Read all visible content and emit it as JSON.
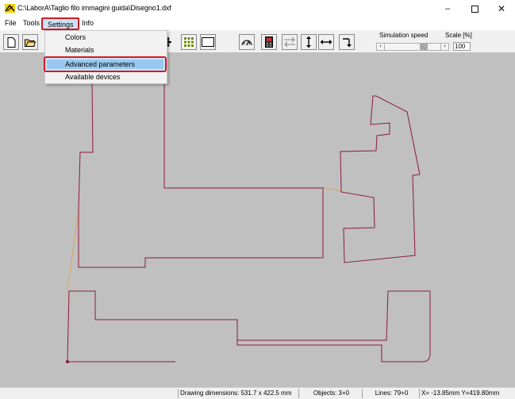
{
  "window": {
    "title": "C:\\LaborA\\Taglio filo immagini guida\\Disegno1.dxf",
    "minimize_icon": "minimize-icon",
    "maximize_icon": "maximize-icon",
    "close_icon": "close-icon"
  },
  "menubar": {
    "file": "File",
    "tools": "Tools",
    "settings": "Settings",
    "info": "Info"
  },
  "settings_menu": {
    "items": [
      "Colors",
      "Materials",
      "Advanced parameters",
      "Available devices"
    ],
    "highlighted": "Advanced parameters"
  },
  "toolbar": {
    "simulation_speed_label": "Simulation speed",
    "scale_label": "Scale [%]",
    "scale_value": "100",
    "icons": [
      "new-file-icon",
      "open-folder-icon",
      "move-icon",
      "grid-icon",
      "rectangle-icon",
      "speed-gauge-icon",
      "device-icon",
      "swap-direction-icon",
      "vertical-arrow-icon",
      "horizontal-arrow-icon",
      "turn-arrow-icon"
    ]
  },
  "colors": {
    "canvas_bg": "#c0c0c0",
    "path_color": "#8b1a3c",
    "travel_color": "#e0a040",
    "highlight_border": "#d21b24",
    "menu_highlight": "#99c9f0"
  },
  "statusbar": {
    "drawing_dimensions": "Drawing dimensions: 531.7 x 422.5 mm",
    "objects": "Objects: 3+0",
    "lines": "Lines: 79+0",
    "coordinates": "X= -13.85mm Y=419.80mm"
  }
}
